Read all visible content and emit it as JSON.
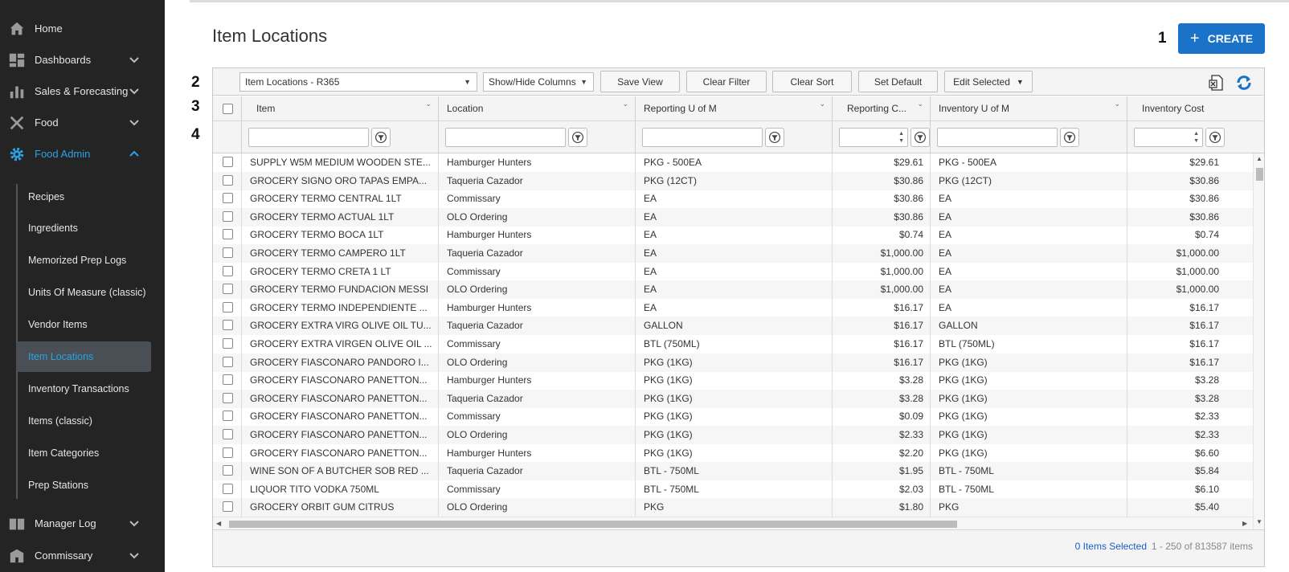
{
  "sidebar": {
    "top_items": [
      {
        "label": "Home",
        "icon": "home-icon"
      },
      {
        "label": "Dashboards",
        "icon": "dashboard-icon"
      },
      {
        "label": "Sales & Forecasting",
        "icon": "bar-chart-icon"
      },
      {
        "label": "Food",
        "icon": "utensils-icon"
      },
      {
        "label": "Food Admin",
        "icon": "gear-icon"
      }
    ],
    "sub_items": [
      {
        "label": "Recipes"
      },
      {
        "label": "Ingredients"
      },
      {
        "label": "Memorized Prep Logs"
      },
      {
        "label": "Units Of Measure (classic)"
      },
      {
        "label": "Vendor Items"
      },
      {
        "label": "Item Locations"
      },
      {
        "label": "Inventory Transactions"
      },
      {
        "label": "Items (classic)"
      },
      {
        "label": "Item Categories"
      },
      {
        "label": "Prep Stations"
      }
    ],
    "bottom_items": [
      {
        "label": "Manager Log",
        "icon": "book-icon"
      },
      {
        "label": "Commissary",
        "icon": "building-icon"
      }
    ],
    "accent_color": "#2aa3e6"
  },
  "page": {
    "title": "Item Locations",
    "create_label": "CREATE",
    "annotations": [
      "1",
      "2",
      "3",
      "4"
    ]
  },
  "toolbar": {
    "view_select": "Item Locations - R365",
    "show_hide": "Show/Hide Columns",
    "save_view": "Save View",
    "clear_filter": "Clear Filter",
    "clear_sort": "Clear Sort",
    "set_default": "Set Default",
    "edit_selected": "Edit Selected",
    "export_icon": "excel-export-icon",
    "refresh_icon": "refresh-icon"
  },
  "columns": [
    "Item",
    "Location",
    "Reporting U of M",
    "Reporting C...",
    "Inventory U of M",
    "Inventory Cost"
  ],
  "rows": [
    [
      "SUPPLY W5M MEDIUM WOODEN STE...",
      "Hamburger Hunters",
      "PKG - 500EA",
      "$29.61",
      "PKG - 500EA",
      "$29.61"
    ],
    [
      "GROCERY SIGNO ORO TAPAS EMPA...",
      "Taqueria Cazador",
      "PKG (12CT)",
      "$30.86",
      "PKG (12CT)",
      "$30.86"
    ],
    [
      "GROCERY TERMO CENTRAL 1LT",
      "Commissary",
      "EA",
      "$30.86",
      "EA",
      "$30.86"
    ],
    [
      "GROCERY TERMO ACTUAL 1LT",
      "OLO Ordering",
      "EA",
      "$30.86",
      "EA",
      "$30.86"
    ],
    [
      "GROCERY TERMO BOCA 1LT",
      "Hamburger Hunters",
      "EA",
      "$0.74",
      "EA",
      "$0.74"
    ],
    [
      "GROCERY TERMO CAMPERO 1LT",
      "Taqueria Cazador",
      "EA",
      "$1,000.00",
      "EA",
      "$1,000.00"
    ],
    [
      "GROCERY TERMO CRETA 1 LT",
      "Commissary",
      "EA",
      "$1,000.00",
      "EA",
      "$1,000.00"
    ],
    [
      "GROCERY TERMO FUNDACION MESSI",
      "OLO Ordering",
      "EA",
      "$1,000.00",
      "EA",
      "$1,000.00"
    ],
    [
      "GROCERY TERMO INDEPENDIENTE ...",
      "Hamburger Hunters",
      "EA",
      "$16.17",
      "EA",
      "$16.17"
    ],
    [
      "GROCERY EXTRA VIRG OLIVE OIL TU...",
      "Taqueria Cazador",
      "GALLON",
      "$16.17",
      "GALLON",
      "$16.17"
    ],
    [
      "GROCERY EXTRA VIRGEN OLIVE OIL ...",
      "Commissary",
      "BTL (750ML)",
      "$16.17",
      "BTL (750ML)",
      "$16.17"
    ],
    [
      "GROCERY FIASCONARO PANDORO I...",
      "OLO Ordering",
      "PKG (1KG)",
      "$16.17",
      "PKG (1KG)",
      "$16.17"
    ],
    [
      "GROCERY FIASCONARO PANETTON...",
      "Hamburger Hunters",
      "PKG (1KG)",
      "$3.28",
      "PKG (1KG)",
      "$3.28"
    ],
    [
      "GROCERY FIASCONARO PANETTON...",
      "Taqueria Cazador",
      "PKG (1KG)",
      "$3.28",
      "PKG (1KG)",
      "$3.28"
    ],
    [
      "GROCERY FIASCONARO PANETTON...",
      "Commissary",
      "PKG (1KG)",
      "$0.09",
      "PKG (1KG)",
      "$2.33"
    ],
    [
      "GROCERY FIASCONARO PANETTON...",
      "OLO Ordering",
      "PKG (1KG)",
      "$2.33",
      "PKG (1KG)",
      "$2.33"
    ],
    [
      "GROCERY FIASCONARO PANETTON...",
      "Hamburger Hunters",
      "PKG (1KG)",
      "$2.20",
      "PKG (1KG)",
      "$6.60"
    ],
    [
      "WINE SON OF A BUTCHER SOB RED ...",
      "Taqueria Cazador",
      "BTL - 750ML",
      "$1.95",
      "BTL - 750ML",
      "$5.84"
    ],
    [
      "LIQUOR TITO VODKA 750ML",
      "Commissary",
      "BTL - 750ML",
      "$2.03",
      "BTL - 750ML",
      "$6.10"
    ],
    [
      "GROCERY ORBIT GUM CITRUS",
      "OLO Ordering",
      "PKG",
      "$1.80",
      "PKG",
      "$5.40"
    ]
  ],
  "footer": {
    "selected": "0 Items Selected",
    "pagination": "1 - 250 of 813587 items"
  }
}
